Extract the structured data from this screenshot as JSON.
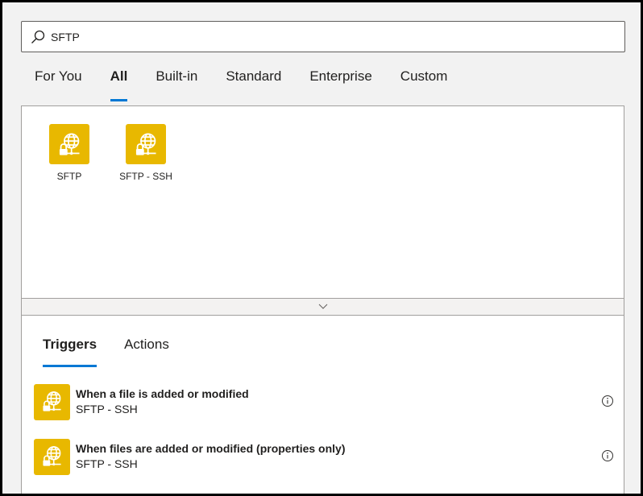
{
  "search": {
    "value": "SFTP",
    "icon": "search-icon"
  },
  "category_tabs": [
    {
      "label": "For You",
      "active": false
    },
    {
      "label": "All",
      "active": true
    },
    {
      "label": "Built-in",
      "active": false
    },
    {
      "label": "Standard",
      "active": false
    },
    {
      "label": "Enterprise",
      "active": false
    },
    {
      "label": "Custom",
      "active": false
    }
  ],
  "connectors": [
    {
      "label": "SFTP",
      "icon": "sftp-globe-lock-icon"
    },
    {
      "label": "SFTP - SSH",
      "icon": "sftp-globe-lock-icon"
    }
  ],
  "collapse": {
    "icon": "chevron-down-icon"
  },
  "operation_tabs": [
    {
      "label": "Triggers",
      "active": true
    },
    {
      "label": "Actions",
      "active": false
    }
  ],
  "operations": [
    {
      "title": "When a file is added or modified",
      "connector": "SFTP - SSH",
      "icon": "sftp-globe-lock-icon",
      "info_icon": "info-icon"
    },
    {
      "title": "When files are added or modified (properties only)",
      "connector": "SFTP - SSH",
      "icon": "sftp-globe-lock-icon",
      "info_icon": "info-icon"
    }
  ],
  "colors": {
    "accent": "#0078d4",
    "connector_tile": "#e8b800",
    "background": "#f2f2f2"
  }
}
